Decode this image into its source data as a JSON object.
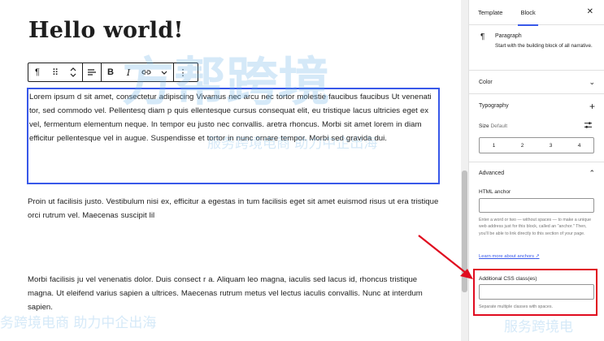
{
  "editor": {
    "title": "Hello world!",
    "toolbar": {
      "buttons": [
        "paragraph-icon",
        "drag-handle-icon",
        "move-updown-icon",
        "align-icon",
        "bold-icon",
        "italic-icon",
        "link-icon",
        "more-chevron-icon",
        "options-icon"
      ],
      "bold_label": "B",
      "italic_label": "I"
    },
    "paragraphs": [
      "Lorem ipsum d   sit amet, consectetur adipiscing  Vivamus nec arcu nec tortor molestie  faucibus faucibus  Ut venenati  tor, sed  commodo vel. Pellentesq  diam p  quis  ellentesque cursus consequat elit, eu tristique lacus  ultricies eget ex vel, fermentum elementum neque. In tempor eu justo nec convallis.  aretra rhoncus. Morbi sit amet lorem in diam efficitur pellentesque vel in augue. Suspendisse et tortor in nunc ornare tempor. Morbi sed gravida dui.",
      "Proin ut  facilisis justo. Vestibulum nisi ex, efficitur a egestas in  tum facilisis eget sit amet  euismod risus ut era  tristique orci rutrum vel. Maecenas suscipit lil",
      "Morbi facilisis ju  vel venenatis dolor. Duis consect  r a. Aliquam leo magna, iaculis sed lacus id, rhoncus tristique magna. Ut eleifend varius sapien a ultrices. Maecenas rutrum metus vel lectus iaculis convallis. Nunc at interdum sapien."
    ]
  },
  "sidebar": {
    "tabs": [
      "Template",
      "Block"
    ],
    "active_tab": "Block",
    "close_icon": "close-icon",
    "block": {
      "icon": "paragraph-icon",
      "name": "Paragraph",
      "description": "Start with the building block of all narrative."
    },
    "color_label": "Color",
    "typography_label": "Typography",
    "size_label": "Size",
    "size_default": "Default",
    "size_options": [
      "1",
      "2",
      "3",
      "4"
    ],
    "advanced_label": "Advanced",
    "html_anchor_label": "HTML anchor",
    "html_anchor_value": "",
    "html_anchor_help": "Enter a word or two — without spaces — to make a unique web address just for this block, called an \"anchor.\" Then, you'll be able to link directly to this section of your page.",
    "learn_more": "Learn more about anchors",
    "css_label": "Additional CSS class(es)",
    "css_value": "",
    "css_help": "Separate multiple classes with spaces."
  },
  "watermark": {
    "cn_line": "服务跨境电商 助力中企出海",
    "cn_title": "方帮跨境",
    "cn_bottom": "服务跨境电",
    "cn_bottom_left": "务跨境电商 助力中企出海"
  },
  "colors": {
    "accent": "#3858e9",
    "highlight_box": "#e00b1f",
    "watermark": "#6cb4e9"
  }
}
